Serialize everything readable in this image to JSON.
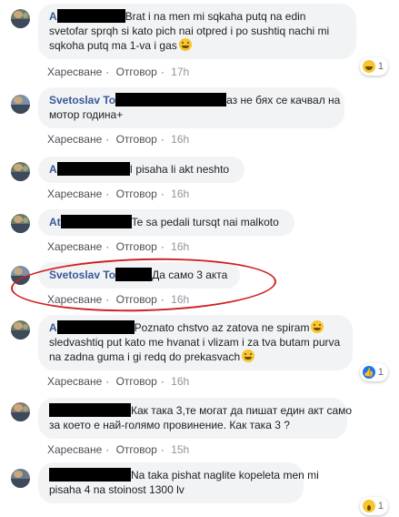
{
  "colors": {
    "name": "#385898",
    "bubble": "#f2f3f5",
    "actions": "#606770",
    "time": "#90949c",
    "highlight": "#d02020"
  },
  "actions": {
    "like": "Харесване",
    "reply": "Отговор",
    "sep": "·"
  },
  "comments": [
    {
      "name": "A",
      "lines": [
        "Brat i na men mi sqkaha putq na edin",
        "svetofar sprqh si kato pich nai otpred i po sushtiq nachi mi",
        "sqkoha putq ma 1-va i gas"
      ],
      "time": "17h",
      "reaction": "haha-icon",
      "reaction_count": "1"
    },
    {
      "name": "Svetoslav To",
      "lines": [
        "аз не бях се качвал на",
        "мотор година+"
      ],
      "time": "16h"
    },
    {
      "name": "A",
      "lines": [
        "I pisaha li akt neshto"
      ],
      "time": "16h"
    },
    {
      "name": "At",
      "lines": [
        "Te sa pedali tursqt nai malkoto"
      ],
      "time": "16h"
    },
    {
      "name": "Svetoslav To",
      "lines": [
        "Да само 3 акта"
      ],
      "time": "16h"
    },
    {
      "name": "A",
      "lines": [
        "Poznato chstvo az zatova ne spiram",
        "sledvashtiq put kato me hvanat i vlizam i za tva butam purva",
        "na zadna guma i gi redq do prekasvach"
      ],
      "time": "16h",
      "reaction": "like-icon",
      "reaction_count": "1"
    },
    {
      "name": "",
      "lines": [
        "Как така 3,те могат да пишат един акт само",
        "за което е най-голямо провинение. Как така 3 ?"
      ],
      "time": "15h"
    },
    {
      "name": "",
      "lines": [
        "Na taka pishat naglite kopeleta men mi",
        "pisaha 4 na stoinost 1300 lv"
      ],
      "time": "15h",
      "reaction": "wow-icon",
      "reaction_count": "1"
    }
  ]
}
